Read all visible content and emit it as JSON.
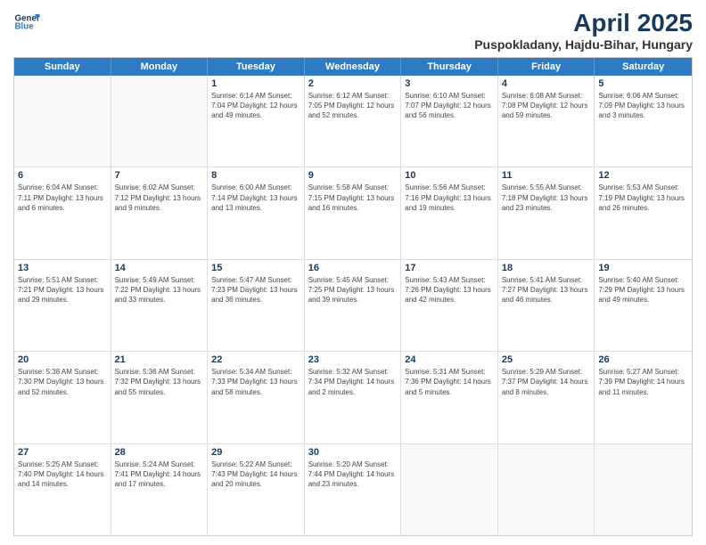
{
  "header": {
    "logo_line1": "General",
    "logo_line2": "Blue",
    "title": "April 2025",
    "subtitle": "Puspokladany, Hajdu-Bihar, Hungary"
  },
  "days": [
    "Sunday",
    "Monday",
    "Tuesday",
    "Wednesday",
    "Thursday",
    "Friday",
    "Saturday"
  ],
  "weeks": [
    [
      {
        "day": "",
        "info": ""
      },
      {
        "day": "",
        "info": ""
      },
      {
        "day": "1",
        "info": "Sunrise: 6:14 AM\nSunset: 7:04 PM\nDaylight: 12 hours and 49 minutes."
      },
      {
        "day": "2",
        "info": "Sunrise: 6:12 AM\nSunset: 7:05 PM\nDaylight: 12 hours and 52 minutes."
      },
      {
        "day": "3",
        "info": "Sunrise: 6:10 AM\nSunset: 7:07 PM\nDaylight: 12 hours and 56 minutes."
      },
      {
        "day": "4",
        "info": "Sunrise: 6:08 AM\nSunset: 7:08 PM\nDaylight: 12 hours and 59 minutes."
      },
      {
        "day": "5",
        "info": "Sunrise: 6:06 AM\nSunset: 7:09 PM\nDaylight: 13 hours and 3 minutes."
      }
    ],
    [
      {
        "day": "6",
        "info": "Sunrise: 6:04 AM\nSunset: 7:11 PM\nDaylight: 13 hours and 6 minutes."
      },
      {
        "day": "7",
        "info": "Sunrise: 6:02 AM\nSunset: 7:12 PM\nDaylight: 13 hours and 9 minutes."
      },
      {
        "day": "8",
        "info": "Sunrise: 6:00 AM\nSunset: 7:14 PM\nDaylight: 13 hours and 13 minutes."
      },
      {
        "day": "9",
        "info": "Sunrise: 5:58 AM\nSunset: 7:15 PM\nDaylight: 13 hours and 16 minutes."
      },
      {
        "day": "10",
        "info": "Sunrise: 5:56 AM\nSunset: 7:16 PM\nDaylight: 13 hours and 19 minutes."
      },
      {
        "day": "11",
        "info": "Sunrise: 5:55 AM\nSunset: 7:18 PM\nDaylight: 13 hours and 23 minutes."
      },
      {
        "day": "12",
        "info": "Sunrise: 5:53 AM\nSunset: 7:19 PM\nDaylight: 13 hours and 26 minutes."
      }
    ],
    [
      {
        "day": "13",
        "info": "Sunrise: 5:51 AM\nSunset: 7:21 PM\nDaylight: 13 hours and 29 minutes."
      },
      {
        "day": "14",
        "info": "Sunrise: 5:49 AM\nSunset: 7:22 PM\nDaylight: 13 hours and 33 minutes."
      },
      {
        "day": "15",
        "info": "Sunrise: 5:47 AM\nSunset: 7:23 PM\nDaylight: 13 hours and 36 minutes."
      },
      {
        "day": "16",
        "info": "Sunrise: 5:45 AM\nSunset: 7:25 PM\nDaylight: 13 hours and 39 minutes."
      },
      {
        "day": "17",
        "info": "Sunrise: 5:43 AM\nSunset: 7:26 PM\nDaylight: 13 hours and 42 minutes."
      },
      {
        "day": "18",
        "info": "Sunrise: 5:41 AM\nSunset: 7:27 PM\nDaylight: 13 hours and 46 minutes."
      },
      {
        "day": "19",
        "info": "Sunrise: 5:40 AM\nSunset: 7:29 PM\nDaylight: 13 hours and 49 minutes."
      }
    ],
    [
      {
        "day": "20",
        "info": "Sunrise: 5:38 AM\nSunset: 7:30 PM\nDaylight: 13 hours and 52 minutes."
      },
      {
        "day": "21",
        "info": "Sunrise: 5:36 AM\nSunset: 7:32 PM\nDaylight: 13 hours and 55 minutes."
      },
      {
        "day": "22",
        "info": "Sunrise: 5:34 AM\nSunset: 7:33 PM\nDaylight: 13 hours and 58 minutes."
      },
      {
        "day": "23",
        "info": "Sunrise: 5:32 AM\nSunset: 7:34 PM\nDaylight: 14 hours and 2 minutes."
      },
      {
        "day": "24",
        "info": "Sunrise: 5:31 AM\nSunset: 7:36 PM\nDaylight: 14 hours and 5 minutes."
      },
      {
        "day": "25",
        "info": "Sunrise: 5:29 AM\nSunset: 7:37 PM\nDaylight: 14 hours and 8 minutes."
      },
      {
        "day": "26",
        "info": "Sunrise: 5:27 AM\nSunset: 7:39 PM\nDaylight: 14 hours and 11 minutes."
      }
    ],
    [
      {
        "day": "27",
        "info": "Sunrise: 5:25 AM\nSunset: 7:40 PM\nDaylight: 14 hours and 14 minutes."
      },
      {
        "day": "28",
        "info": "Sunrise: 5:24 AM\nSunset: 7:41 PM\nDaylight: 14 hours and 17 minutes."
      },
      {
        "day": "29",
        "info": "Sunrise: 5:22 AM\nSunset: 7:43 PM\nDaylight: 14 hours and 20 minutes."
      },
      {
        "day": "30",
        "info": "Sunrise: 5:20 AM\nSunset: 7:44 PM\nDaylight: 14 hours and 23 minutes."
      },
      {
        "day": "",
        "info": ""
      },
      {
        "day": "",
        "info": ""
      },
      {
        "day": "",
        "info": ""
      }
    ]
  ]
}
